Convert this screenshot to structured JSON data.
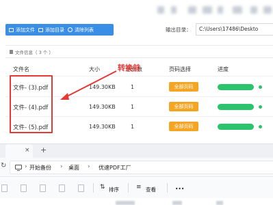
{
  "toolbar": {
    "add_file": "添加文件",
    "add_folder": "添加目录",
    "clear_list": "清除列表",
    "output_label": "输出目录：",
    "output_path": "C:\\Users\\17486\\Deskto"
  },
  "file_info": "文件信息（ 3 个 ）",
  "table": {
    "headers": [
      "文件名",
      "大小",
      "总页数",
      "页码选择",
      "进度"
    ],
    "rows": [
      {
        "name": "文件- (3).pdf",
        "size": "149.30KB",
        "pages": "1",
        "select": "全部页码",
        "progress": 1.0
      },
      {
        "name": "文件- (4).pdf",
        "size": "149.30KB",
        "pages": "1",
        "select": "全部页码",
        "progress": 1.0
      },
      {
        "name": "文件- (5).pdf",
        "size": "149.30KB",
        "pages": "1",
        "select": "全部页码",
        "progress": 1.0
      }
    ]
  },
  "annotation": {
    "label": "转换前",
    "color": "#e53935"
  },
  "explorer": {
    "tab_close": "×",
    "tab_add": "+",
    "refresh_icon": "↻",
    "breadcrumb": [
      "开始备份",
      "桌面",
      "优速PDF工厂"
    ],
    "sep": "›",
    "sort_label": "排序",
    "view_label": "查看",
    "more": "•••"
  },
  "colors": {
    "accent": "#3a8ee6",
    "page_select": "#f5a524",
    "progress": "#2bc36b"
  }
}
